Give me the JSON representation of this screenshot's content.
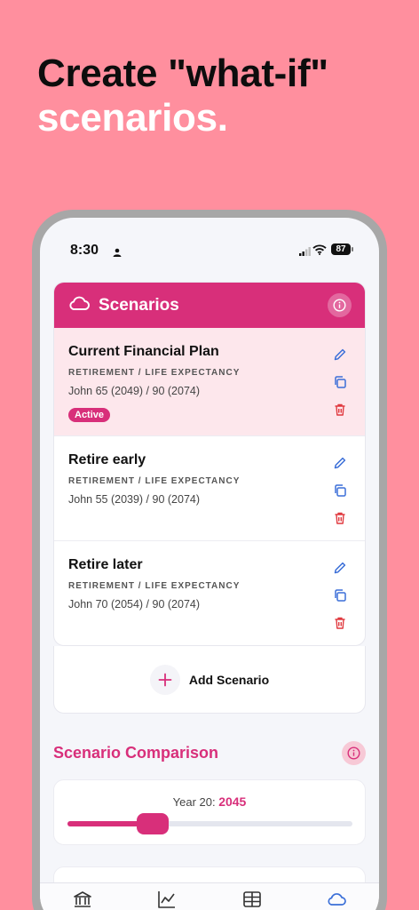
{
  "headline": {
    "line1": "Create \"what-if\"",
    "line2": "scenarios."
  },
  "status": {
    "time": "8:30",
    "battery": "87"
  },
  "scenarios": {
    "title": "Scenarios",
    "items": [
      {
        "name": "Current Financial Plan",
        "subtitle": "RETIREMENT / LIFE EXPECTANCY",
        "detail": "John 65 (2049) / 90 (2074)",
        "badge": "Active"
      },
      {
        "name": "Retire early",
        "subtitle": "RETIREMENT / LIFE EXPECTANCY",
        "detail": "John 55 (2039) / 90 (2074)"
      },
      {
        "name": "Retire later",
        "subtitle": "RETIREMENT / LIFE EXPECTANCY",
        "detail": "John 70 (2054) / 90 (2074)"
      }
    ],
    "add_label": "Add Scenario"
  },
  "comparison": {
    "title": "Scenario Comparison",
    "year_label": "Year 20:",
    "year_value": "2045",
    "slider_fraction": 0.3
  },
  "colors": {
    "accent": "#d82f7a",
    "background": "#ff8f9e",
    "active_row": "#fde7ec",
    "action_blue": "#3b6fd8",
    "delete_red": "#e0393e"
  },
  "icons": {
    "header": "cloud-icon",
    "actions": [
      "pencil-icon",
      "copy-icon",
      "trash-icon"
    ],
    "tabs": [
      "bank-icon",
      "chart-line-icon",
      "table-icon",
      "cloud-icon"
    ]
  }
}
